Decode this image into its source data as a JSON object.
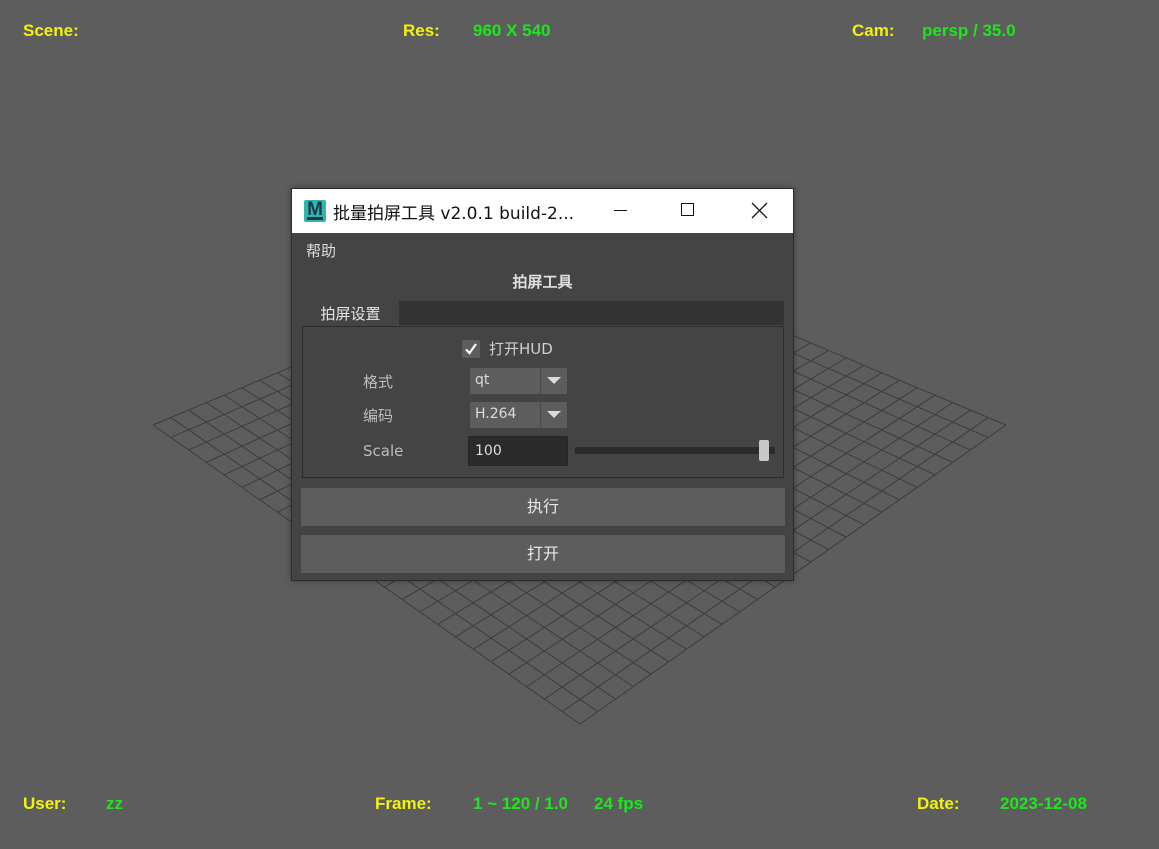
{
  "hud": {
    "scene_label": "Scene:",
    "scene_value": "",
    "res_label": "Res:",
    "res_value": "960 X 540",
    "cam_label": "Cam:",
    "cam_value": "persp / 35.0",
    "user_label": "User:",
    "user_value": "zz",
    "frame_label": "Frame:",
    "frame_value": "1 ~ 120 / 1.0",
    "fps_value": "24 fps",
    "date_label": "Date:",
    "date_value": "2023-12-08"
  },
  "dialog": {
    "title": "批量拍屏工具 v2.0.1 build-2...",
    "app_icon": "maya-icon",
    "menu": [
      "帮助"
    ],
    "section_title": "拍屏工具",
    "tab": "拍屏设置",
    "hud_checkbox": {
      "label": "打开HUD",
      "checked": true
    },
    "format": {
      "label": "格式",
      "value": "qt"
    },
    "encoding": {
      "label": "编码",
      "value": "H.264"
    },
    "scale": {
      "label": "Scale",
      "value": "100",
      "slider_fraction": 0.97
    },
    "run_button": "执行",
    "open_button": "打开"
  },
  "colors": {
    "viewport_bg": "#5d5d5d",
    "grid_line": "#3c3c3c",
    "hud_label": "#f2f20a",
    "hud_value": "#1ee61e",
    "dialog_bg": "#444444",
    "button_bg": "#5d5d5d"
  }
}
